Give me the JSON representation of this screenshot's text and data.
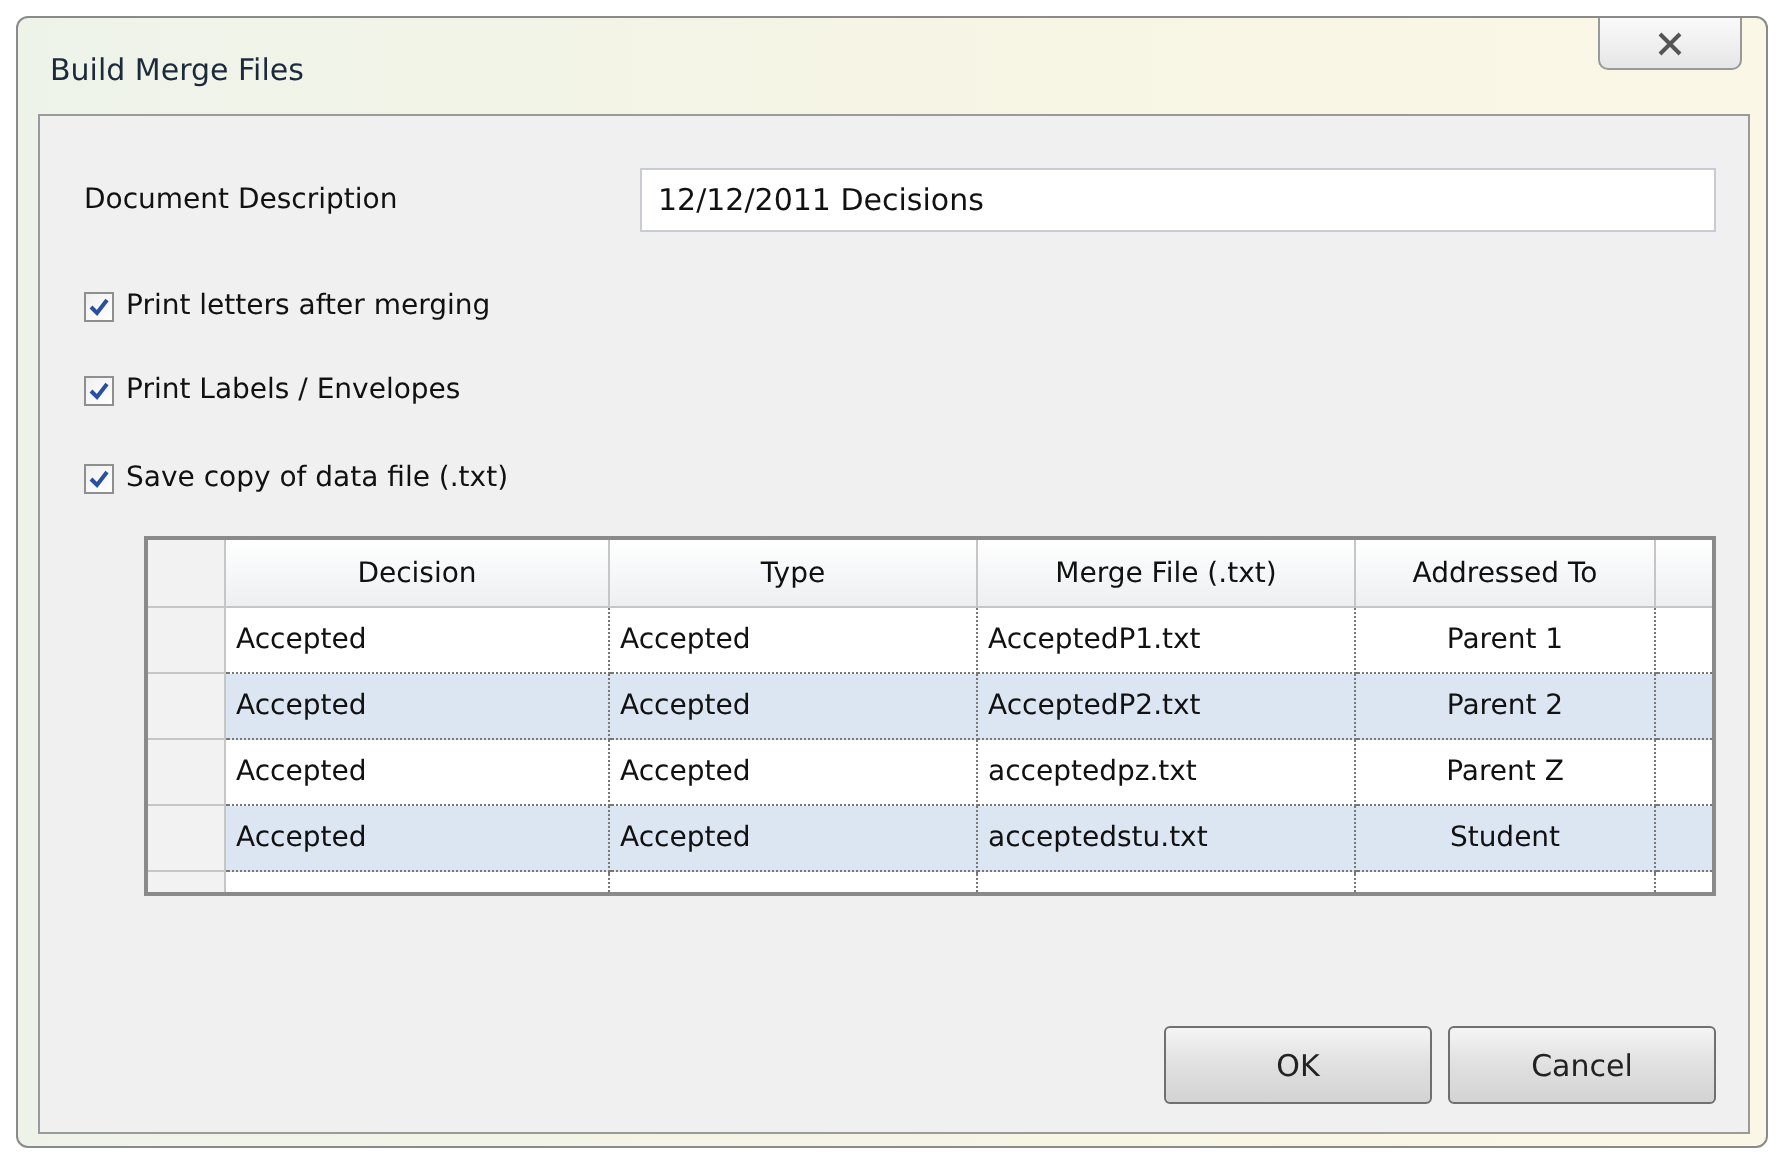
{
  "window": {
    "title": "Build Merge Files"
  },
  "description": {
    "label": "Document Description",
    "value": "12/12/2011 Decisions"
  },
  "options": [
    {
      "label": "Print letters after merging",
      "checked": true
    },
    {
      "label": "Print Labels / Envelopes",
      "checked": true
    },
    {
      "label": "Save copy of data file (.txt)",
      "checked": true
    }
  ],
  "table": {
    "columns": [
      "Decision",
      "Type",
      "Merge File (.txt)",
      "Addressed To"
    ],
    "rows": [
      [
        "Accepted",
        "Accepted",
        "AcceptedP1.txt",
        "Parent 1"
      ],
      [
        "Accepted",
        "Accepted",
        "AcceptedP2.txt",
        "Parent 2"
      ],
      [
        "Accepted",
        "Accepted",
        "acceptedpz.txt",
        "Parent Z"
      ],
      [
        "Accepted",
        "Accepted",
        "acceptedstu.txt",
        "Student"
      ]
    ]
  },
  "buttons": [
    "OK",
    "Cancel"
  ]
}
